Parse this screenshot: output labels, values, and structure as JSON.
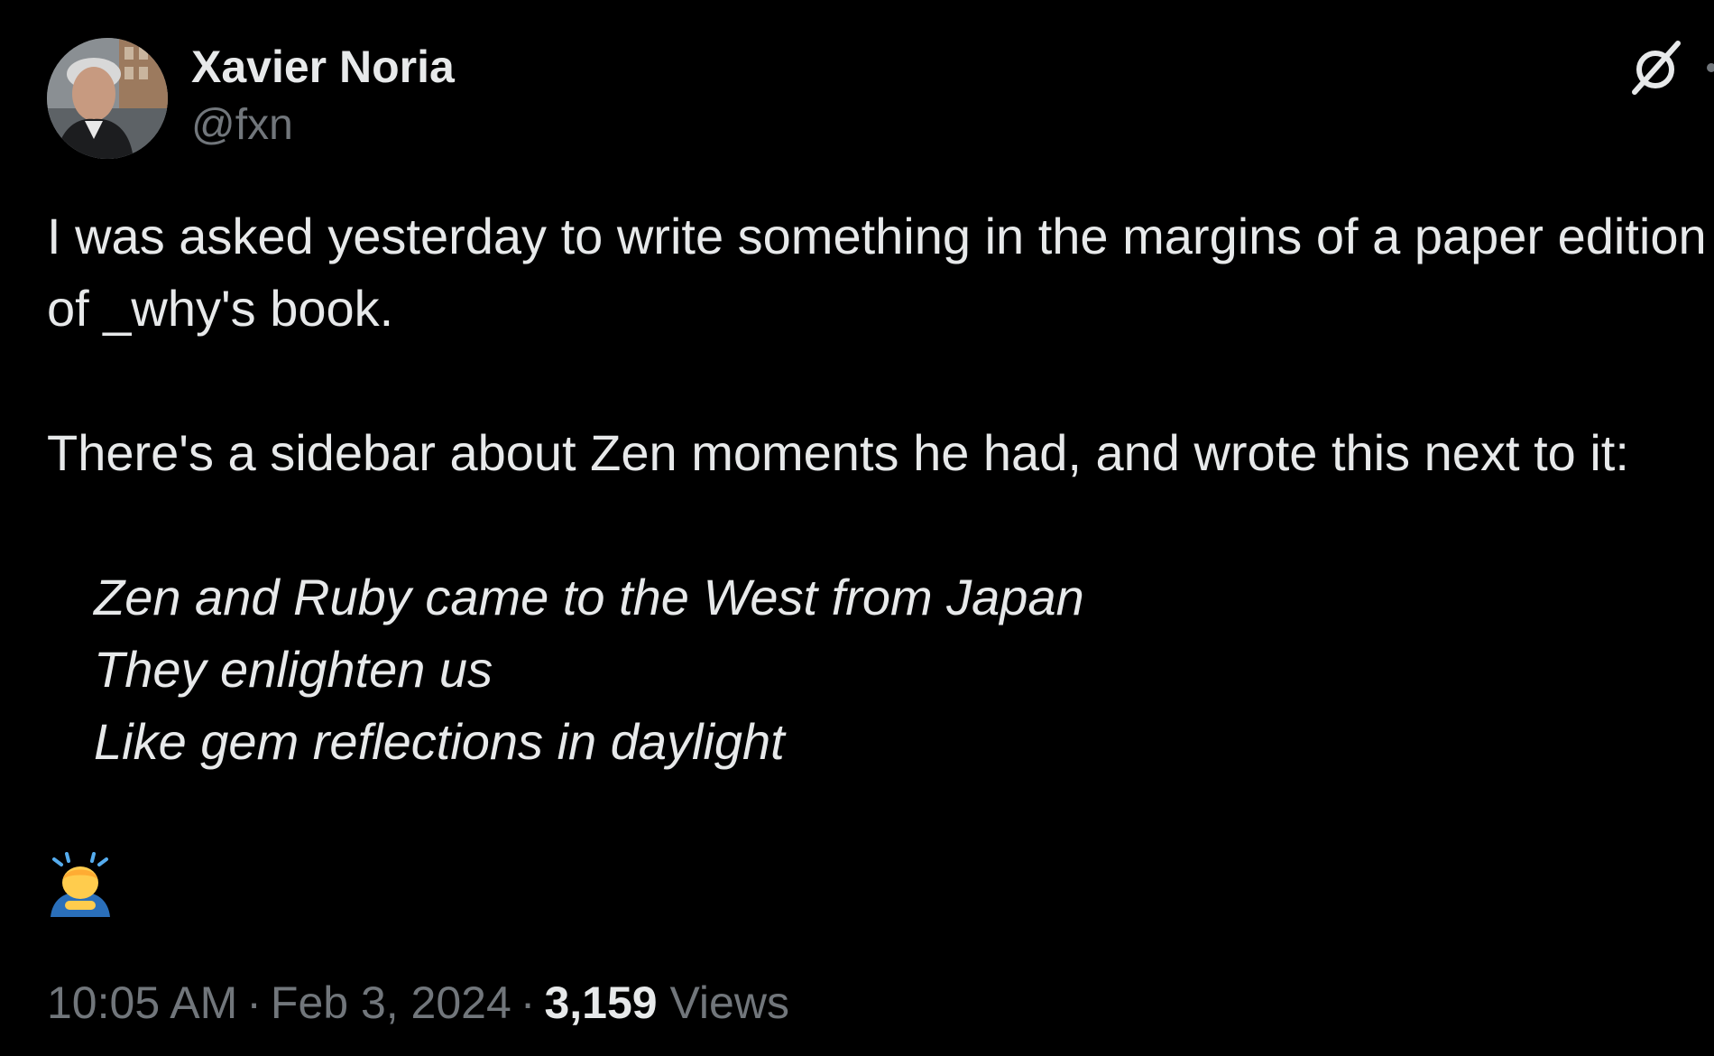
{
  "author": {
    "display_name": "Xavier Noria",
    "handle": "@fxn"
  },
  "post": {
    "paragraph_1": "I was asked yesterday to write something in the margins of a paper edition of _why's book.",
    "paragraph_2": "There's a sidebar about Zen moments he had, and wrote this next to it:",
    "poem_lines": [
      "Zen and Ruby came to the West from Japan",
      "They enlighten us",
      "Like gem reflections in daylight"
    ],
    "emoji": "🙇‍♂️"
  },
  "meta": {
    "time": "10:05 AM",
    "date": "Feb 3, 2024",
    "separator": "·",
    "views_count": "3,159",
    "views_label": "Views"
  },
  "icons": {
    "grok": "grok-icon",
    "more": "more-icon"
  },
  "colors": {
    "background": "#000000",
    "text_primary": "#e7e9ea",
    "text_secondary": "#71767b"
  }
}
